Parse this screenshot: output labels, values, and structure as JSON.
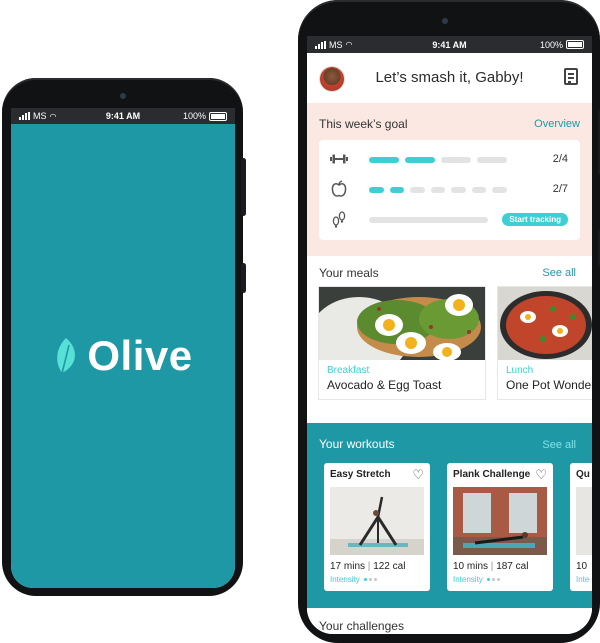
{
  "status_bar": {
    "carrier": "MS",
    "time": "9:41 AM",
    "battery": "100%"
  },
  "splash": {
    "brand": "Olive",
    "brand_color": "#1f98a6"
  },
  "header": {
    "greeting": "Let’s smash it, Gabby!"
  },
  "weekly_goal": {
    "title": "This week’s goal",
    "link": "Overview",
    "rows": [
      {
        "icon": "dumbbell-icon",
        "progress_done": 2,
        "progress_total": 4,
        "count": "2/4"
      },
      {
        "icon": "apple-icon",
        "progress_done": 2,
        "progress_total": 7,
        "count": "2/7"
      },
      {
        "icon": "footsteps-icon",
        "action": "Start tracking"
      }
    ]
  },
  "meals": {
    "title": "Your meals",
    "link": "See all",
    "items": [
      {
        "type": "Breakfast",
        "name": "Avocado & Egg Toast"
      },
      {
        "type": "Lunch",
        "name": "One Pot Wonder"
      }
    ]
  },
  "workouts": {
    "title": "Your workouts",
    "link": "See all",
    "items": [
      {
        "title": "Easy Stretch",
        "mins": "17 mins",
        "cal": "122 cal",
        "intensity": "Intensity",
        "intensity_level": 1,
        "intensity_max": 3
      },
      {
        "title": "Plank Challenge",
        "mins": "10 mins",
        "cal": "187 cal",
        "intensity": "Intensity",
        "intensity_level": 1,
        "intensity_max": 3
      },
      {
        "title": "Qu",
        "mins": "10",
        "intensity": "Inte"
      }
    ]
  },
  "challenges": {
    "title": "Your challenges"
  },
  "colors": {
    "teal": "#1f98a6",
    "accent": "#3dcfd3",
    "goal_bg": "#fbe8e2",
    "segment_empty": "#e3e3e3"
  }
}
